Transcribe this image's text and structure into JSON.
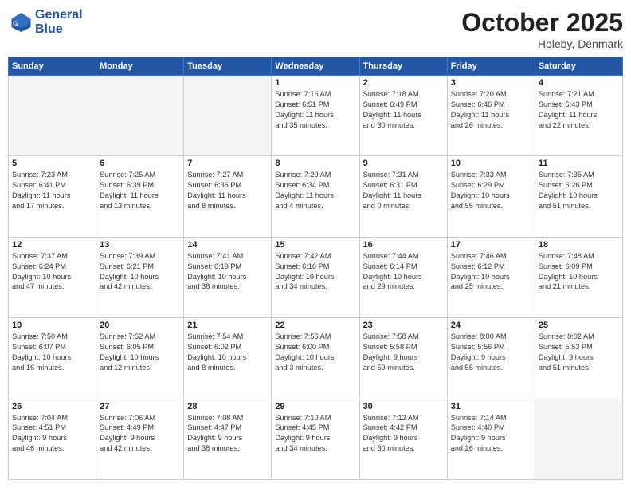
{
  "header": {
    "logo_line1": "General",
    "logo_line2": "Blue",
    "month": "October 2025",
    "location": "Holeby, Denmark"
  },
  "weekdays": [
    "Sunday",
    "Monday",
    "Tuesday",
    "Wednesday",
    "Thursday",
    "Friday",
    "Saturday"
  ],
  "weeks": [
    [
      {
        "day": "",
        "info": ""
      },
      {
        "day": "",
        "info": ""
      },
      {
        "day": "",
        "info": ""
      },
      {
        "day": "1",
        "info": "Sunrise: 7:16 AM\nSunset: 6:51 PM\nDaylight: 11 hours\nand 35 minutes."
      },
      {
        "day": "2",
        "info": "Sunrise: 7:18 AM\nSunset: 6:49 PM\nDaylight: 11 hours\nand 30 minutes."
      },
      {
        "day": "3",
        "info": "Sunrise: 7:20 AM\nSunset: 6:46 PM\nDaylight: 11 hours\nand 26 minutes."
      },
      {
        "day": "4",
        "info": "Sunrise: 7:21 AM\nSunset: 6:43 PM\nDaylight: 11 hours\nand 22 minutes."
      }
    ],
    [
      {
        "day": "5",
        "info": "Sunrise: 7:23 AM\nSunset: 6:41 PM\nDaylight: 11 hours\nand 17 minutes."
      },
      {
        "day": "6",
        "info": "Sunrise: 7:25 AM\nSunset: 6:39 PM\nDaylight: 11 hours\nand 13 minutes."
      },
      {
        "day": "7",
        "info": "Sunrise: 7:27 AM\nSunset: 6:36 PM\nDaylight: 11 hours\nand 8 minutes."
      },
      {
        "day": "8",
        "info": "Sunrise: 7:29 AM\nSunset: 6:34 PM\nDaylight: 11 hours\nand 4 minutes."
      },
      {
        "day": "9",
        "info": "Sunrise: 7:31 AM\nSunset: 6:31 PM\nDaylight: 11 hours\nand 0 minutes."
      },
      {
        "day": "10",
        "info": "Sunrise: 7:33 AM\nSunset: 6:29 PM\nDaylight: 10 hours\nand 55 minutes."
      },
      {
        "day": "11",
        "info": "Sunrise: 7:35 AM\nSunset: 6:26 PM\nDaylight: 10 hours\nand 51 minutes."
      }
    ],
    [
      {
        "day": "12",
        "info": "Sunrise: 7:37 AM\nSunset: 6:24 PM\nDaylight: 10 hours\nand 47 minutes."
      },
      {
        "day": "13",
        "info": "Sunrise: 7:39 AM\nSunset: 6:21 PM\nDaylight: 10 hours\nand 42 minutes."
      },
      {
        "day": "14",
        "info": "Sunrise: 7:41 AM\nSunset: 6:19 PM\nDaylight: 10 hours\nand 38 minutes."
      },
      {
        "day": "15",
        "info": "Sunrise: 7:42 AM\nSunset: 6:16 PM\nDaylight: 10 hours\nand 34 minutes."
      },
      {
        "day": "16",
        "info": "Sunrise: 7:44 AM\nSunset: 6:14 PM\nDaylight: 10 hours\nand 29 minutes."
      },
      {
        "day": "17",
        "info": "Sunrise: 7:46 AM\nSunset: 6:12 PM\nDaylight: 10 hours\nand 25 minutes."
      },
      {
        "day": "18",
        "info": "Sunrise: 7:48 AM\nSunset: 6:09 PM\nDaylight: 10 hours\nand 21 minutes."
      }
    ],
    [
      {
        "day": "19",
        "info": "Sunrise: 7:50 AM\nSunset: 6:07 PM\nDaylight: 10 hours\nand 16 minutes."
      },
      {
        "day": "20",
        "info": "Sunrise: 7:52 AM\nSunset: 6:05 PM\nDaylight: 10 hours\nand 12 minutes."
      },
      {
        "day": "21",
        "info": "Sunrise: 7:54 AM\nSunset: 6:02 PM\nDaylight: 10 hours\nand 8 minutes."
      },
      {
        "day": "22",
        "info": "Sunrise: 7:56 AM\nSunset: 6:00 PM\nDaylight: 10 hours\nand 3 minutes."
      },
      {
        "day": "23",
        "info": "Sunrise: 7:58 AM\nSunset: 5:58 PM\nDaylight: 9 hours\nand 59 minutes."
      },
      {
        "day": "24",
        "info": "Sunrise: 8:00 AM\nSunset: 5:56 PM\nDaylight: 9 hours\nand 55 minutes."
      },
      {
        "day": "25",
        "info": "Sunrise: 8:02 AM\nSunset: 5:53 PM\nDaylight: 9 hours\nand 51 minutes."
      }
    ],
    [
      {
        "day": "26",
        "info": "Sunrise: 7:04 AM\nSunset: 4:51 PM\nDaylight: 9 hours\nand 46 minutes."
      },
      {
        "day": "27",
        "info": "Sunrise: 7:06 AM\nSunset: 4:49 PM\nDaylight: 9 hours\nand 42 minutes."
      },
      {
        "day": "28",
        "info": "Sunrise: 7:08 AM\nSunset: 4:47 PM\nDaylight: 9 hours\nand 38 minutes."
      },
      {
        "day": "29",
        "info": "Sunrise: 7:10 AM\nSunset: 4:45 PM\nDaylight: 9 hours\nand 34 minutes."
      },
      {
        "day": "30",
        "info": "Sunrise: 7:12 AM\nSunset: 4:42 PM\nDaylight: 9 hours\nand 30 minutes."
      },
      {
        "day": "31",
        "info": "Sunrise: 7:14 AM\nSunset: 4:40 PM\nDaylight: 9 hours\nand 26 minutes."
      },
      {
        "day": "",
        "info": ""
      }
    ]
  ]
}
